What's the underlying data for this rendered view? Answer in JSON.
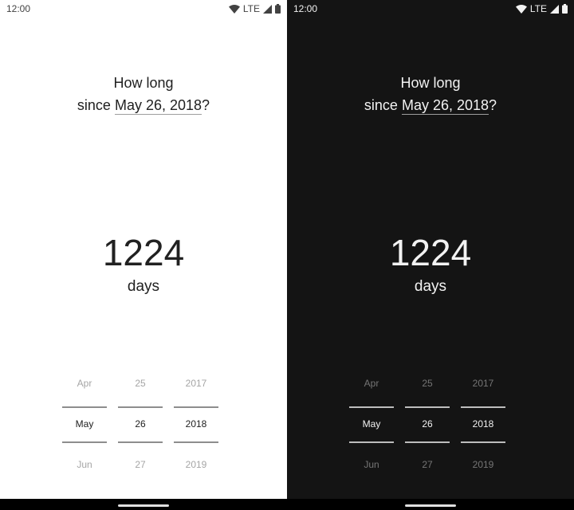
{
  "status_bar": {
    "time": "12:00",
    "network": "LTE"
  },
  "question": {
    "line1": "How long",
    "prefix": "since",
    "date": "May 26, 2018",
    "suffix": "?"
  },
  "result": {
    "count": "1224",
    "unit": "days"
  },
  "picker": {
    "month": {
      "prev": "Apr",
      "selected": "May",
      "next": "Jun"
    },
    "day": {
      "prev": "25",
      "selected": "26",
      "next": "27"
    },
    "year": {
      "prev": "2017",
      "selected": "2018",
      "next": "2019"
    }
  },
  "icons": {
    "wifi": "wifi-icon",
    "signal": "signal-icon",
    "battery": "battery-icon"
  },
  "colors": {
    "light_bg": "#ffffff",
    "dark_bg": "#141414"
  }
}
